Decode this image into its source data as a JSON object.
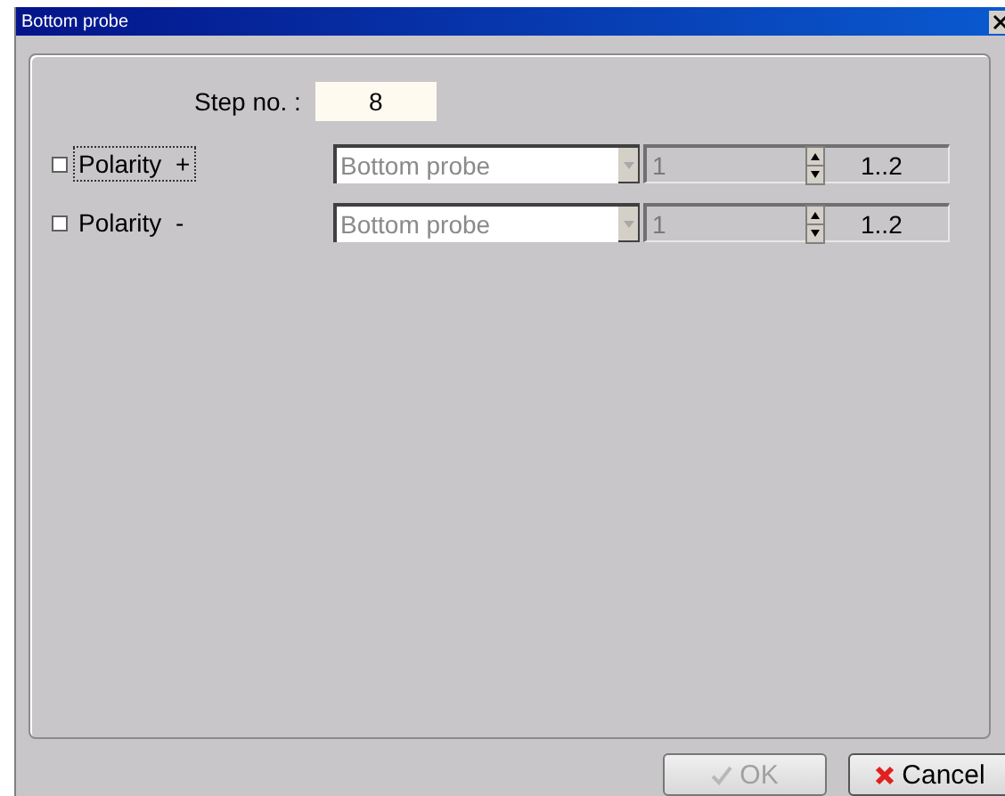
{
  "window": {
    "title": "Bottom probe"
  },
  "step": {
    "label": "Step no. :",
    "value": "8"
  },
  "rows": [
    {
      "label": "Polarity  +",
      "checked": false,
      "focused": true,
      "combo": {
        "value": "Bottom probe",
        "disabled": true
      },
      "spinner": {
        "value": "1",
        "disabled": true
      },
      "range": "1..2"
    },
    {
      "label": "Polarity  -",
      "checked": false,
      "focused": false,
      "combo": {
        "value": "Bottom probe",
        "disabled": true
      },
      "spinner": {
        "value": "1",
        "disabled": true
      },
      "range": "1..2"
    }
  ],
  "buttons": [
    {
      "kind": "ok",
      "label": "OK",
      "disabled": true
    },
    {
      "kind": "cancel",
      "label": "Cancel",
      "disabled": false
    }
  ]
}
